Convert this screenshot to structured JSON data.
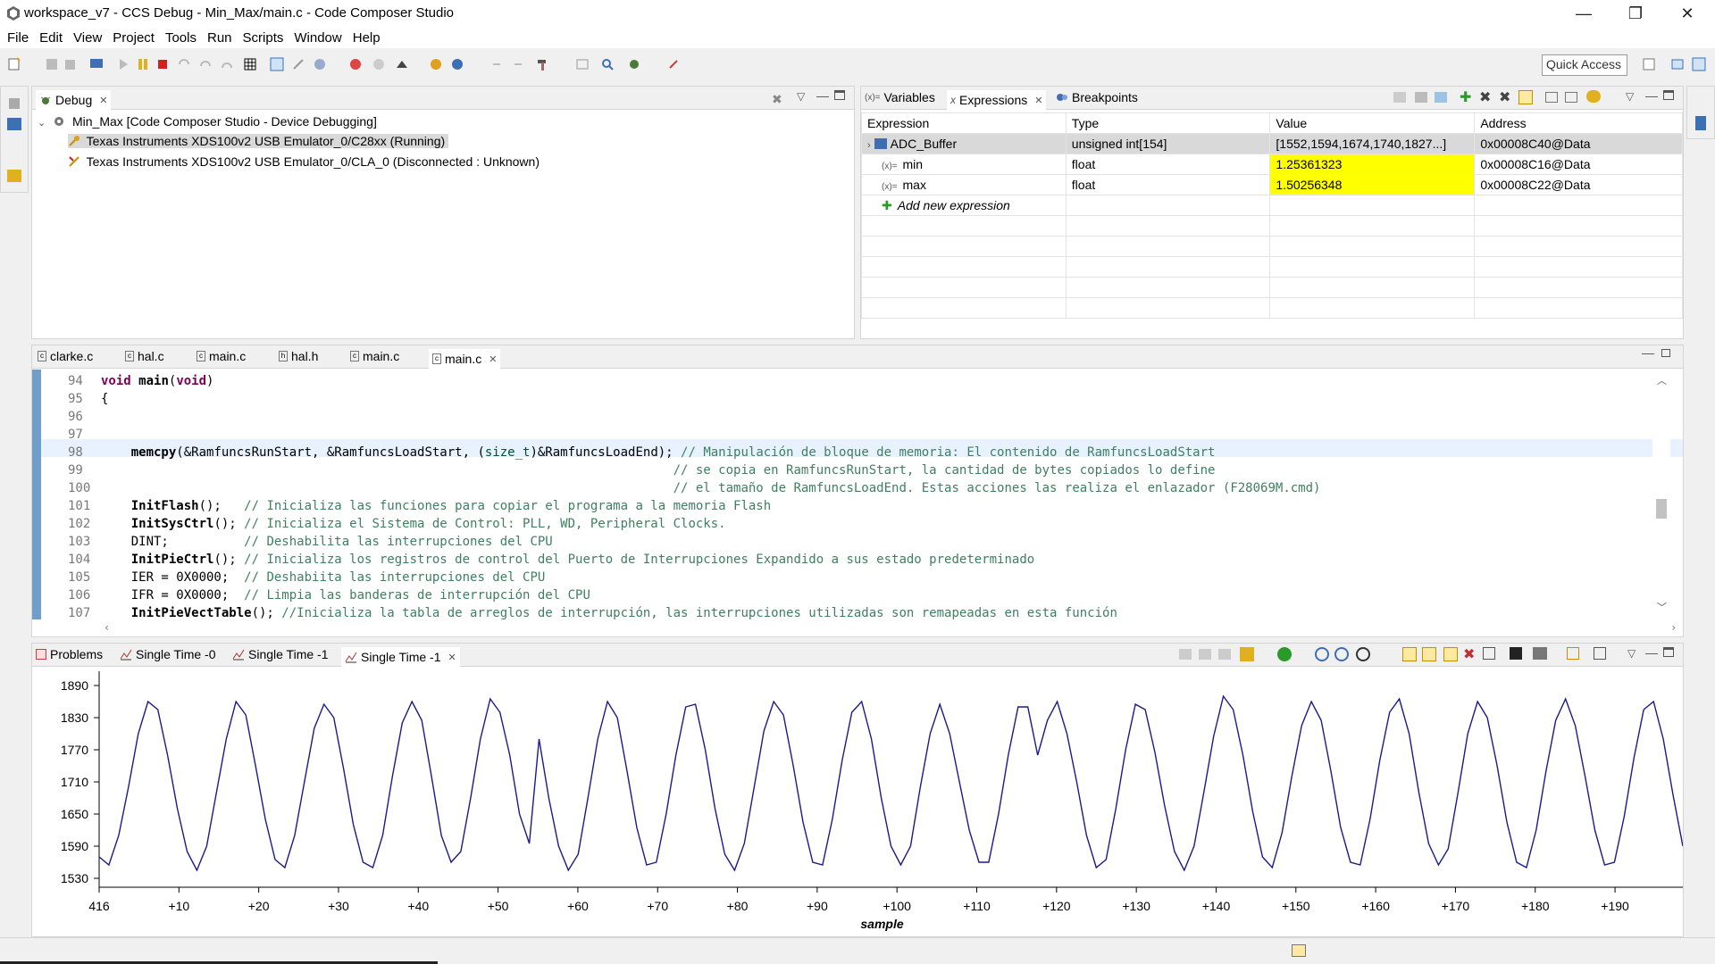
{
  "window": {
    "title": "workspace_v7 - CCS Debug - Min_Max/main.c - Code Composer Studio",
    "minimize": "—",
    "restore": "❐",
    "close": "✕"
  },
  "menu": [
    "File",
    "Edit",
    "View",
    "Project",
    "Tools",
    "Run",
    "Scripts",
    "Window",
    "Help"
  ],
  "toolbar": {
    "quick_access": "Quick Access"
  },
  "debug_view": {
    "tab": "Debug",
    "root": "Min_Max [Code Composer Studio - Device Debugging]",
    "items": [
      "Texas Instruments XDS100v2 USB Emulator_0/C28xx (Running)",
      "Texas Instruments XDS100v2 USB Emulator_0/CLA_0 (Disconnected : Unknown)"
    ]
  },
  "expressions_view": {
    "tabs": [
      "Variables",
      "Expressions",
      "Breakpoints"
    ],
    "columns": [
      "Expression",
      "Type",
      "Value",
      "Address"
    ],
    "rows": [
      {
        "expression": "ADC_Buffer",
        "type": "unsigned int[154]",
        "value": "[1552,1594,1674,1740,1827...]",
        "address": "0x00008C40@Data",
        "highlight": false
      },
      {
        "expression": "min",
        "type": "float",
        "value": "1.25361323",
        "address": "0x00008C16@Data",
        "highlight": true
      },
      {
        "expression": "max",
        "type": "float",
        "value": "1.50256348",
        "address": "0x00008C22@Data",
        "highlight": true
      }
    ],
    "add_new": "Add new expression",
    "highlight_color": "#ffff00"
  },
  "editor": {
    "tabs": [
      "clarke.c",
      "hal.c",
      "main.c",
      "hal.h",
      "main.c",
      "main.c"
    ],
    "active_tab": 5,
    "lines": [
      {
        "n": "94",
        "code": "void main(void)"
      },
      {
        "n": "95",
        "code": "{"
      },
      {
        "n": "96",
        "code": ""
      },
      {
        "n": "97",
        "code": ""
      },
      {
        "n": "98",
        "code": "    memcpy(&RamfuncsRunStart, &RamfuncsLoadStart, (size_t)&RamfuncsLoadEnd); ",
        "comment": "// Manipulación de bloque de memoria: El contenido de RamfuncsLoadStart"
      },
      {
        "n": "99",
        "code": "                                                                            ",
        "comment": "// se copia en RamfuncsRunStart, la cantidad de bytes copiados lo define"
      },
      {
        "n": "100",
        "code": "                                                                            ",
        "comment": "// el tamaño de RamfuncsLoadEnd. Estas acciones las realiza el enlazador (F28069M.cmd)"
      },
      {
        "n": "101",
        "code": "    InitFlash();   ",
        "comment": "// Inicializa las funciones para copiar el programa a la memoria Flash"
      },
      {
        "n": "102",
        "code": "    InitSysCtrl(); ",
        "comment": "// Inicializa el Sistema de Control: PLL, WD, Peripheral Clocks."
      },
      {
        "n": "103",
        "code": "    DINT;          ",
        "comment": "// Deshabilita las interrupciones del CPU"
      },
      {
        "n": "104",
        "code": "    InitPieCtrl(); ",
        "comment": "// Inicializa los registros de control del Puerto de Interrupciones Expandido a sus estado predeterminado"
      },
      {
        "n": "105",
        "code": "    IER = 0X0000;  ",
        "comment": "// Deshabiita las interrupciones del CPU"
      },
      {
        "n": "106",
        "code": "    IFR = 0X0000;  ",
        "comment": "// Limpia las banderas de interrupción del CPU"
      },
      {
        "n": "107",
        "code": "    InitPieVectTable(); ",
        "comment": "//Inicializa la tabla de arreglos de interrupción, las interrupciones utilizadas son remapeadas en esta función"
      }
    ]
  },
  "graph_view": {
    "tabs": [
      "Problems",
      "Single Time -0",
      "Single Time -1",
      "Single Time -1"
    ],
    "active_tab": 3
  },
  "chart_data": {
    "type": "line",
    "xlabel": "sample",
    "ylabel": "",
    "x_tick_labels": [
      "416",
      "+10",
      "+20",
      "+30",
      "+40",
      "+50",
      "+60",
      "+70",
      "+80",
      "+90",
      "+100",
      "+110",
      "+120",
      "+130",
      "+140",
      "+150",
      "+160",
      "+170",
      "+180",
      "+190"
    ],
    "x_ticks": [
      0,
      10,
      20,
      30,
      40,
      50,
      60,
      70,
      80,
      90,
      100,
      110,
      120,
      130,
      140,
      150,
      160,
      170,
      180,
      190
    ],
    "y_ticks": [
      1530,
      1590,
      1650,
      1710,
      1770,
      1830,
      1890
    ],
    "xlim": [
      0,
      198.5
    ],
    "ylim": [
      1520,
      1910
    ],
    "line_color": "#1a1a8c",
    "series": [
      {
        "values": [
          1570,
          1555,
          1610,
          1700,
          1800,
          1860,
          1845,
          1760,
          1660,
          1580,
          1545,
          1590,
          1690,
          1790,
          1860,
          1835,
          1740,
          1640,
          1565,
          1550,
          1610,
          1710,
          1810,
          1855,
          1830,
          1735,
          1630,
          1560,
          1550,
          1610,
          1720,
          1820,
          1860,
          1825,
          1720,
          1610,
          1560,
          1580,
          1680,
          1790,
          1865,
          1840,
          1760,
          1650,
          1595,
          1790,
          1680,
          1590,
          1545,
          1575,
          1680,
          1790,
          1860,
          1830,
          1730,
          1625,
          1555,
          1560,
          1650,
          1760,
          1850,
          1855,
          1770,
          1660,
          1575,
          1545,
          1595,
          1700,
          1805,
          1860,
          1835,
          1740,
          1635,
          1560,
          1555,
          1640,
          1750,
          1840,
          1860,
          1790,
          1680,
          1590,
          1555,
          1590,
          1700,
          1800,
          1855,
          1800,
          1710,
          1620,
          1560,
          1560,
          1650,
          1760,
          1850,
          1850,
          1760,
          1825,
          1860,
          1800,
          1710,
          1610,
          1550,
          1565,
          1660,
          1770,
          1855,
          1845,
          1765,
          1665,
          1580,
          1545,
          1590,
          1690,
          1795,
          1870,
          1845,
          1760,
          1655,
          1570,
          1550,
          1615,
          1720,
          1815,
          1860,
          1825,
          1730,
          1625,
          1560,
          1555,
          1640,
          1750,
          1840,
          1865,
          1800,
          1690,
          1595,
          1555,
          1585,
          1690,
          1800,
          1860,
          1830,
          1740,
          1635,
          1560,
          1550,
          1620,
          1730,
          1825,
          1865,
          1815,
          1720,
          1620,
          1555,
          1560,
          1645,
          1755,
          1845,
          1860,
          1790,
          1685,
          1590
        ]
      }
    ]
  }
}
